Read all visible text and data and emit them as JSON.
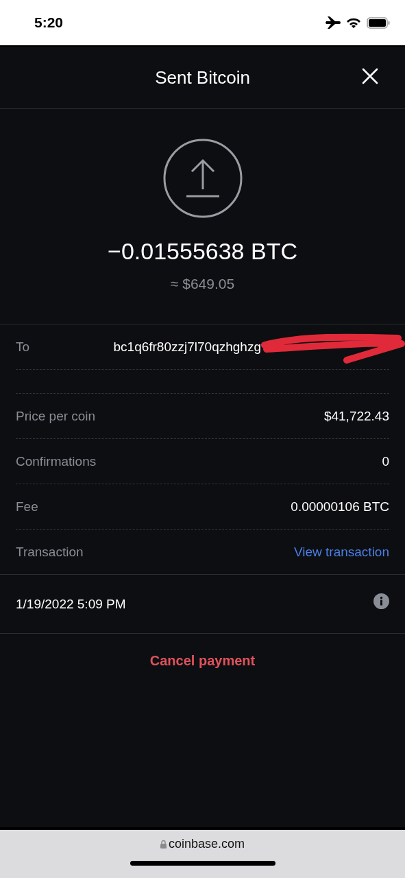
{
  "status_bar": {
    "time": "5:20"
  },
  "header": {
    "title": "Sent Bitcoin"
  },
  "summary": {
    "amount": "−0.01555638 BTC",
    "fiat": "≈ $649.05"
  },
  "details": [
    {
      "kind": "address",
      "label": "To",
      "value": "bc1q6fr80zzj7l70qzhghzg"
    },
    {
      "kind": "blank"
    },
    {
      "kind": "text",
      "label": "Price per coin",
      "value": "$41,722.43"
    },
    {
      "kind": "text",
      "label": "Confirmations",
      "value": "0"
    },
    {
      "kind": "text",
      "label": "Fee",
      "value": "0.00000106 BTC"
    },
    {
      "kind": "link",
      "label": "Transaction",
      "value": "View transaction"
    }
  ],
  "date": "1/19/2022 5:09 PM",
  "cancel_button": "Cancel payment",
  "browser_bar": {
    "url": "coinbase.com"
  }
}
